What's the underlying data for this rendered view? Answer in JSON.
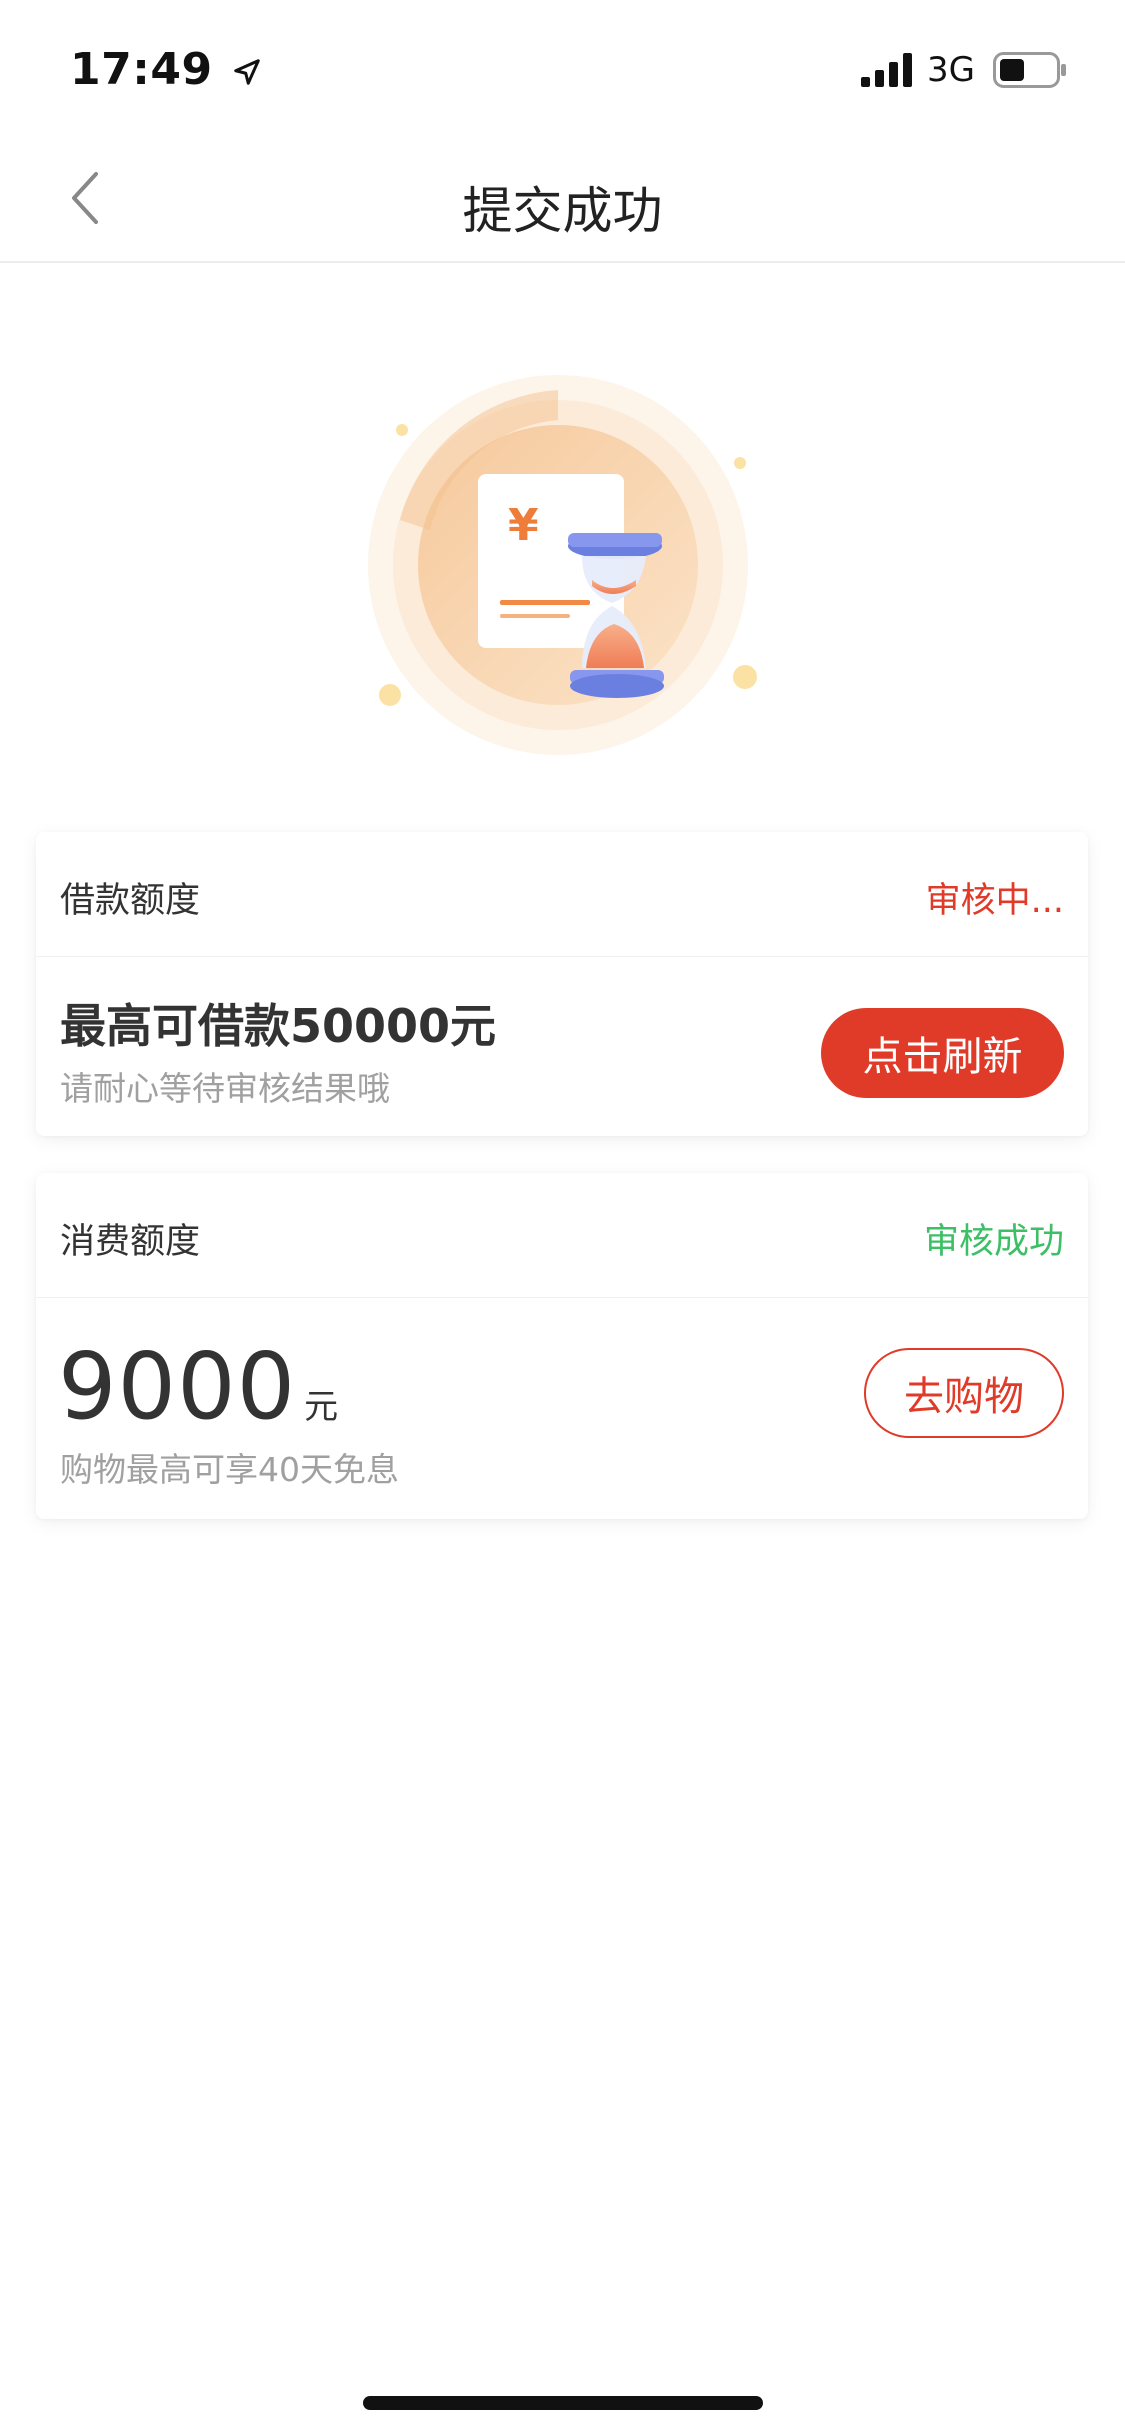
{
  "status_bar": {
    "time": "17:49",
    "network": "3G",
    "icons": [
      "location-arrow-icon",
      "signal-icon",
      "battery-icon"
    ]
  },
  "nav": {
    "title": "提交成功",
    "back_icon": "chevron-left-icon"
  },
  "illustration": {
    "icons": [
      "yuan-document-icon",
      "hourglass-icon"
    ],
    "currency_symbol": "¥"
  },
  "loan_card": {
    "title": "借款额度",
    "status": "审核中...",
    "amount_text": "最高可借款50000元",
    "note": "请耐心等待审核结果哦",
    "button_label": "点击刷新"
  },
  "shop_card": {
    "title": "消费额度",
    "status": "审核成功",
    "amount": "9000",
    "unit": "元",
    "note": "购物最高可享40天免息",
    "button_label": "去购物"
  },
  "colors": {
    "accent_red": "#e03a28",
    "success_green": "#3dbf66",
    "muted_text": "#a0a0a0",
    "primary_text": "#333333"
  }
}
